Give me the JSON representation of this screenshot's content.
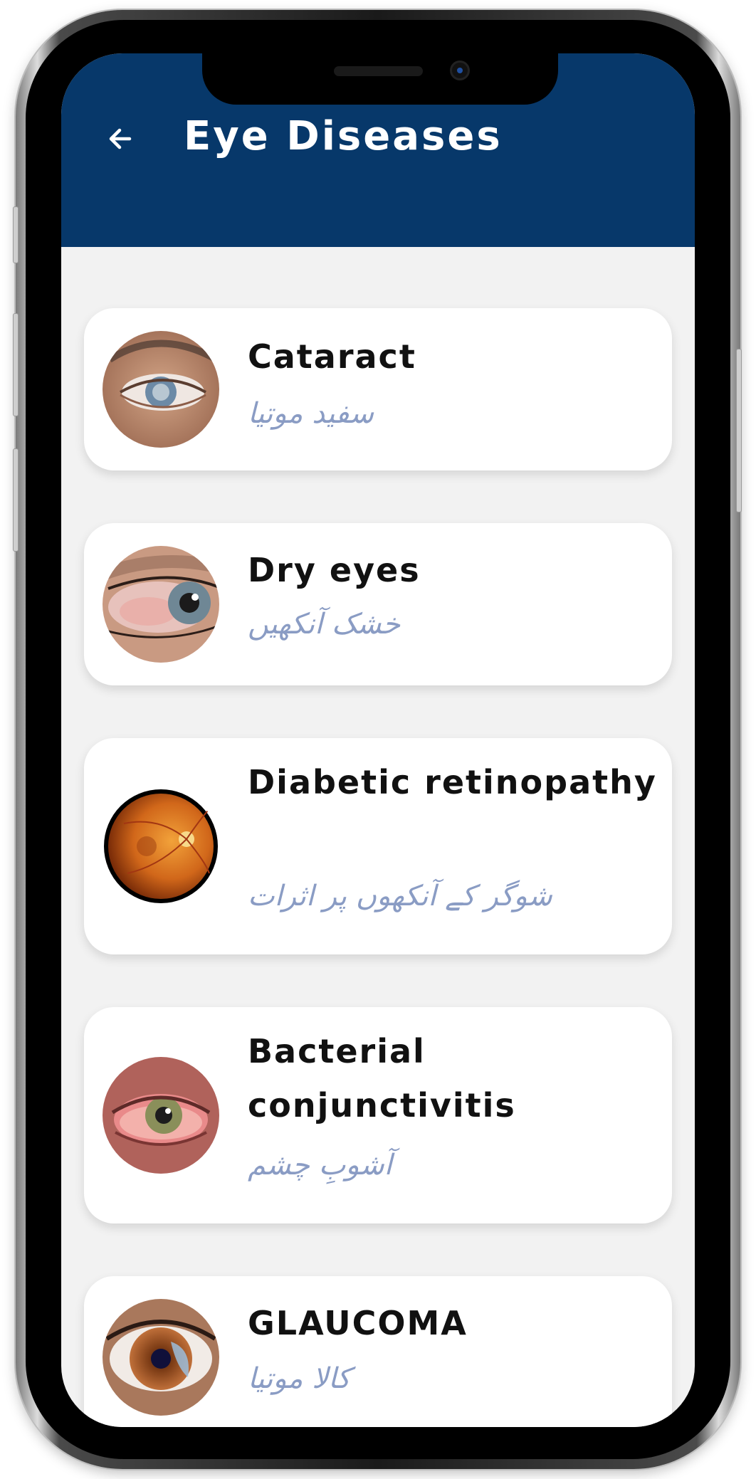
{
  "header": {
    "title": "Eye Diseases",
    "back_icon": "←"
  },
  "colors": {
    "appbar": "#07386a",
    "background": "#f2f2f2",
    "subtitle": "#8a9cc4"
  },
  "diseases": [
    {
      "title": "Cataract",
      "subtitle": "سفید موتیا"
    },
    {
      "title": "Dry eyes",
      "subtitle": "خشک آنکھیں"
    },
    {
      "title": "Diabetic retinopathy",
      "subtitle": "شوگر کے آنکھوں پر اثرات"
    },
    {
      "title": "Bacterial conjunctivitis",
      "subtitle": "آشوبِ چشم"
    },
    {
      "title": "GLAUCOMA",
      "subtitle": "کالا موتیا"
    }
  ]
}
